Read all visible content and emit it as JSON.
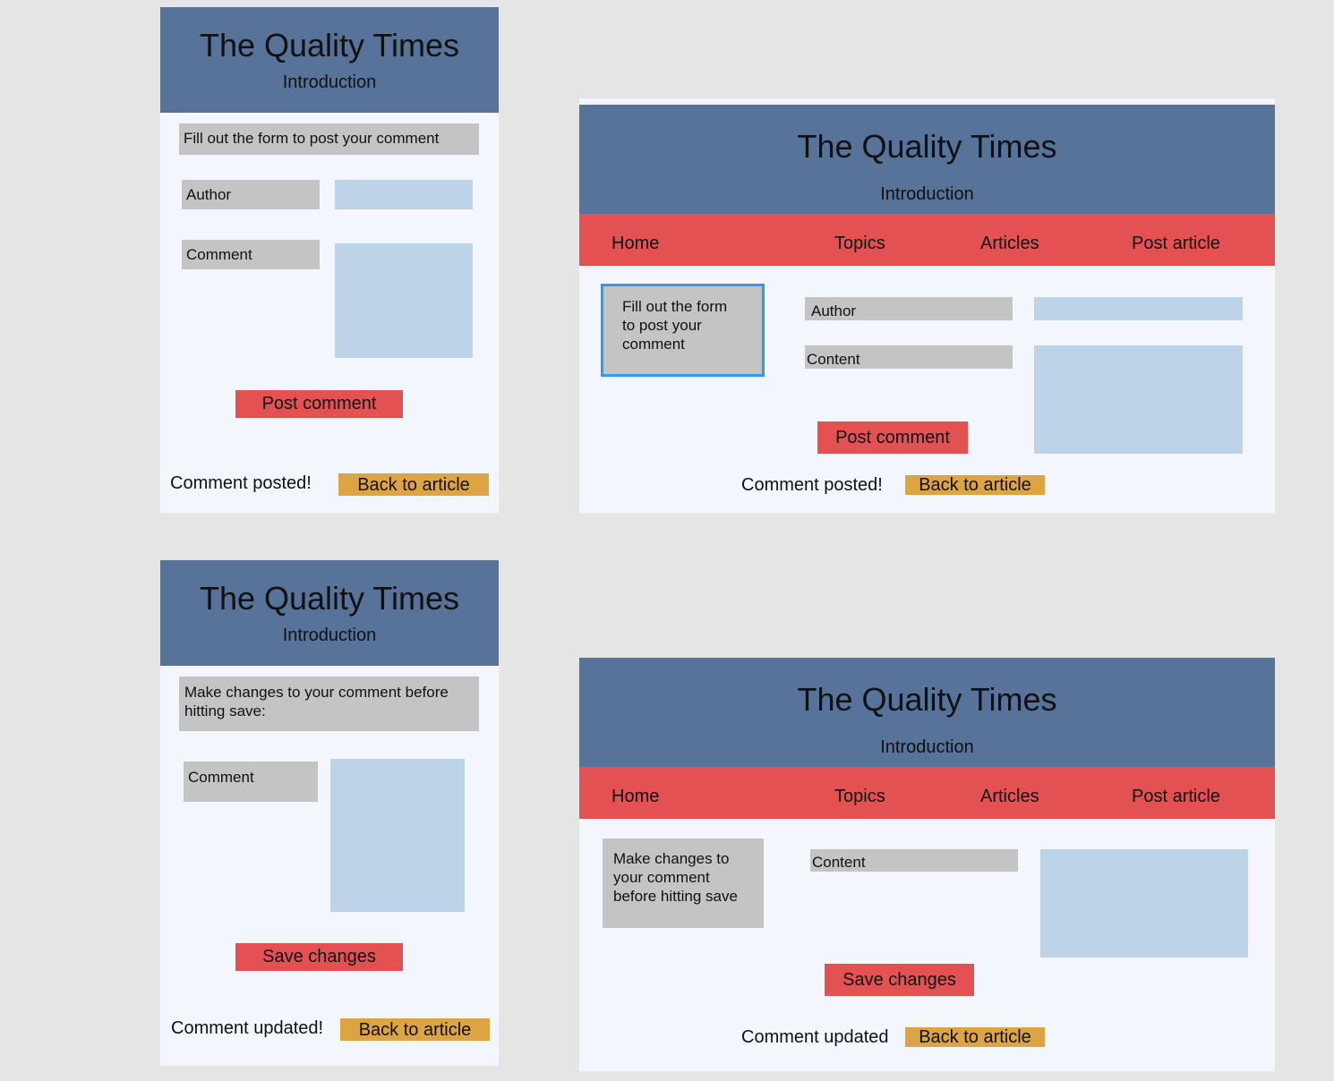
{
  "site": {
    "title": "The Quality Times",
    "subtitle": "Introduction",
    "nav": [
      "Home",
      "Topics",
      "Articles",
      "Post article"
    ]
  },
  "post_comment_mobile": {
    "instruction": "Fill out the form to post your comment",
    "author_label": "Author",
    "comment_label": "Comment",
    "author_value": "",
    "comment_value": "",
    "submit_label": "Post comment",
    "status": "Comment posted!",
    "back_label": "Back to article"
  },
  "post_comment_desktop": {
    "instruction": "Fill out the form to post your comment",
    "author_label": "Author",
    "content_label": "Content",
    "author_value": "",
    "content_value": "",
    "submit_label": "Post comment",
    "status": "Comment posted!",
    "back_label": "Back to article",
    "colors": {
      "focus_outline": "#2f9bf0"
    }
  },
  "edit_comment_mobile": {
    "instruction": "Make changes to your comment before hitting save:",
    "comment_label": "Comment",
    "comment_value": "",
    "submit_label": "Save changes",
    "status": "Comment updated!",
    "back_label": "Back to article"
  },
  "edit_comment_desktop": {
    "instruction": "Make changes to your comment before hitting save",
    "content_label": "Content",
    "content_value": "",
    "submit_label": "Save changes",
    "status": "Comment updated",
    "back_label": "Back to article"
  },
  "colors": {
    "background": "#e5e5e5",
    "page": "#f4f6fd",
    "header": "#57739a",
    "nav": "#e45152",
    "label_box": "#c4c4c4",
    "input": "#bdd3e7",
    "primary_button": "#e45152",
    "secondary_button": "#dca443"
  }
}
